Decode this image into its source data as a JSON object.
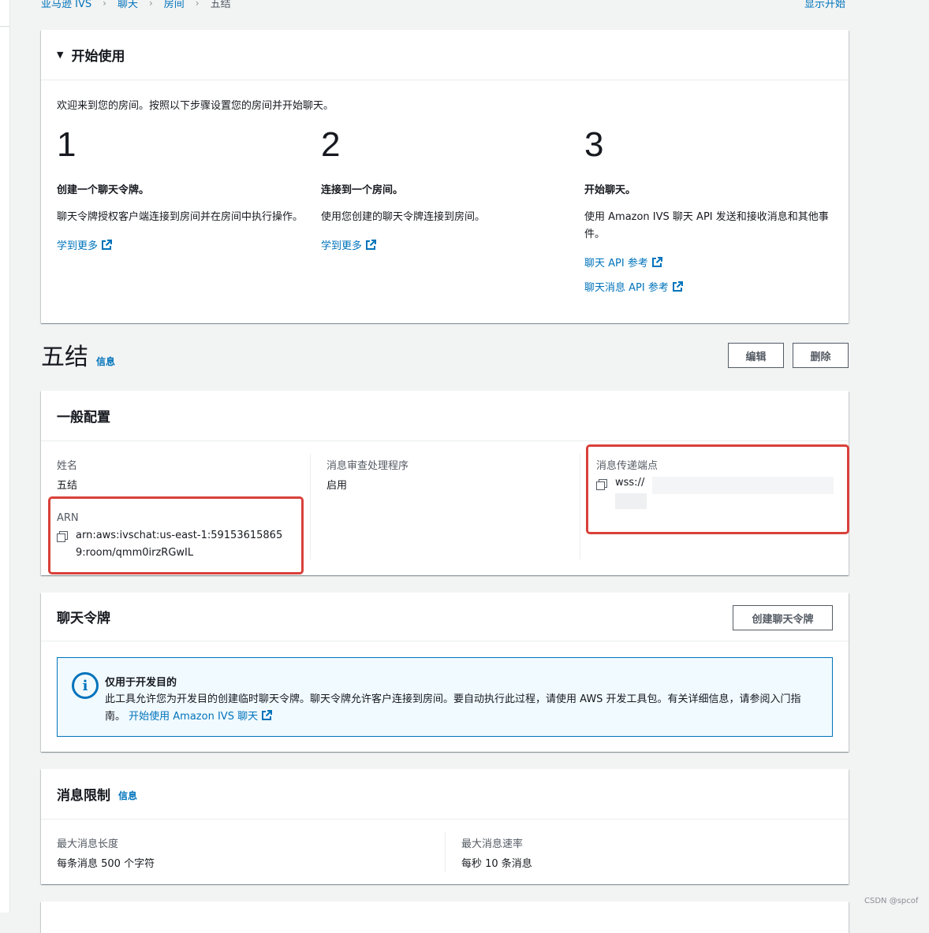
{
  "breadcrumb": [
    "亚马逊 IVS",
    "聊天",
    "房间",
    "五结"
  ],
  "top_right_link": "显示开始",
  "getting_started": {
    "title": "开始使用",
    "intro": "欢迎来到您的房间。按照以下步骤设置您的房间并开始聊天。",
    "steps": [
      {
        "num": "1",
        "title": "创建一个聊天令牌。",
        "desc": "聊天令牌授权客户端连接到房间并在房间中执行操作。",
        "links": [
          "学到更多"
        ]
      },
      {
        "num": "2",
        "title": "连接到一个房间。",
        "desc": "使用您创建的聊天令牌连接到房间。",
        "links": [
          "学到更多"
        ]
      },
      {
        "num": "3",
        "title": "开始聊天。",
        "desc": "使用 Amazon IVS 聊天 API 发送和接收消息和其他事件。",
        "links": [
          "聊天 API 参考",
          "聊天消息 API 参考"
        ]
      }
    ]
  },
  "room": {
    "name": "五结",
    "info": "信息",
    "edit": "编辑",
    "delete": "删除"
  },
  "general": {
    "title": "一般配置",
    "name_label": "姓名",
    "name_value": "五结",
    "arn_label": "ARN",
    "arn_value": "arn:aws:ivschat:us-east-1:591536158659:room/qmm0irzRGwIL",
    "handler_label": "消息审查处理程序",
    "handler_value": "启用",
    "endpoint_label": "消息传递端点",
    "endpoint_value": "wss://"
  },
  "chat_token": {
    "title": "聊天令牌",
    "create_button": "创建聊天令牌",
    "alert_title": "仅用于开发目的",
    "alert_body": "此工具允许您为开发目的创建临时聊天令牌。聊天令牌允许客户连接到房间。要自动执行此过程，请使用 AWS 开发工具包。有关详细信息，请参阅入门指南。",
    "alert_link": "开始使用 Amazon IVS 聊天"
  },
  "limits": {
    "title": "消息限制",
    "info": "信息",
    "len_label": "最大消息长度",
    "len_value": "每条消息 500 个字符",
    "rate_label": "最大消息速率",
    "rate_value": "每秒 10 条消息"
  },
  "watermark": "CSDN @spcof",
  "colors": {
    "link": "#0073bb",
    "highlight": "#d9403a",
    "alert_bg": "#f1faff"
  }
}
